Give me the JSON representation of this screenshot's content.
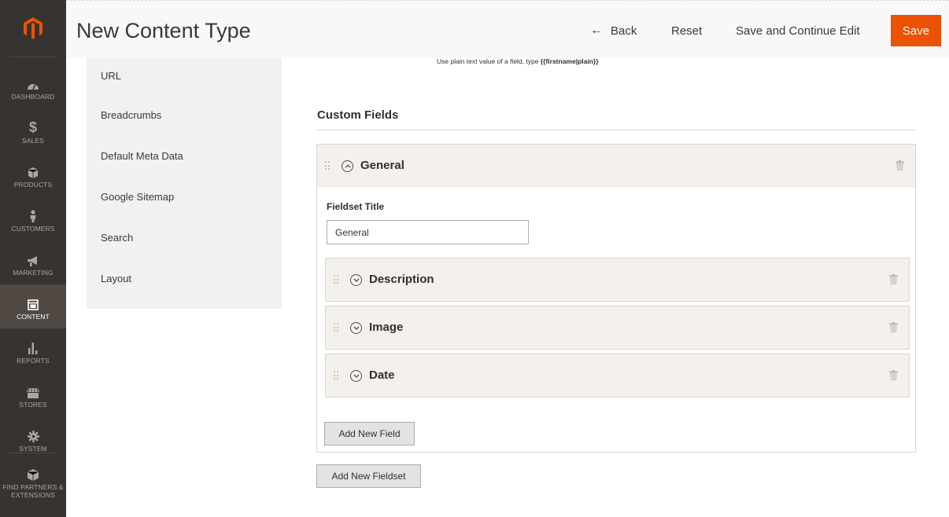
{
  "sidebar": {
    "items": [
      {
        "label": "Dashboard",
        "icon": "dashboard-icon"
      },
      {
        "label": "Sales",
        "icon": "dollar-icon"
      },
      {
        "label": "Products",
        "icon": "box-icon"
      },
      {
        "label": "Customers",
        "icon": "person-icon"
      },
      {
        "label": "Marketing",
        "icon": "megaphone-icon"
      },
      {
        "label": "Content",
        "icon": "layout-icon",
        "active": true
      },
      {
        "label": "Reports",
        "icon": "bar-chart-icon"
      },
      {
        "label": "Stores",
        "icon": "storefront-icon"
      },
      {
        "label": "System",
        "icon": "gear-icon"
      },
      {
        "label": "Find Partners & Extensions",
        "icon": "cube-icon"
      }
    ]
  },
  "header": {
    "title": "New Content Type",
    "back_label": "Back",
    "reset_label": "Reset",
    "save_continue_label": "Save and Continue Edit",
    "save_label": "Save"
  },
  "tabs": [
    "URL",
    "Breadcrumbs",
    "Default Meta Data",
    "Google Sitemap",
    "Search",
    "Layout"
  ],
  "hint": {
    "prefix": "Use plain text value of a field, type ",
    "code": "{{firstname|plain}}"
  },
  "custom_fields": {
    "title": "Custom Fields",
    "fieldset": {
      "name": "General",
      "title_label": "Fieldset Title",
      "title_value": "General",
      "fields": [
        "Description",
        "Image",
        "Date"
      ],
      "add_field_label": "Add New Field"
    },
    "add_fieldset_label": "Add New Fieldset"
  },
  "colors": {
    "sidebar_bg": "#373330",
    "sidebar_active": "#514943",
    "save_button": "#eb5202",
    "header_bg": "#f8f8f8",
    "row_bg": "#f4f1ec"
  }
}
